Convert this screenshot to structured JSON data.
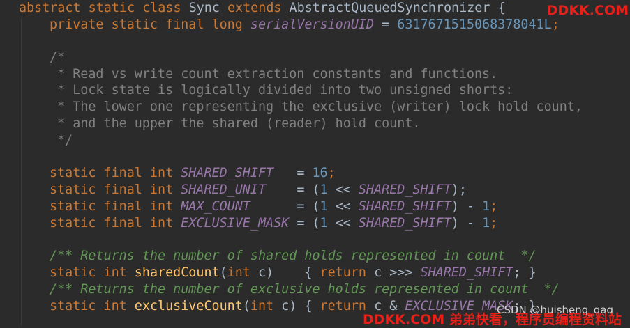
{
  "code": {
    "l1": {
      "kw": "abstract static class ",
      "cls": "Sync ",
      "kw2": "extends ",
      "sup": "AbstractQueuedSynchronizer {"
    },
    "l2": {
      "kw": "private static final long ",
      "fld": "serialVersionUID",
      "eq": " = ",
      "num": "6317671515068378041L",
      "semi": ";"
    },
    "c1": "/*",
    "c2": " * Read vs write count extraction constants and functions.",
    "c3": " * Lock state is logically divided into two unsigned shorts:",
    "c4": " * The lower one representing the exclusive (writer) lock hold count,",
    "c5": " * and the upper the shared (reader) hold count.",
    "c6": " */",
    "s1": {
      "kw": "static final int ",
      "fld": "SHARED_SHIFT",
      "eq": "   = ",
      "num": "16",
      "semi": ";"
    },
    "s2": {
      "kw": "static final int ",
      "fld": "SHARED_UNIT",
      "eq": "    = (",
      "num": "1",
      "op": " << ",
      "fld2": "SHARED_SHIFT",
      "end": ");"
    },
    "s3": {
      "kw": "static final int ",
      "fld": "MAX_COUNT",
      "eq": "      = (",
      "num": "1",
      "op": " << ",
      "fld2": "SHARED_SHIFT",
      "mid": ") - ",
      "num2": "1",
      "semi": ";"
    },
    "s4": {
      "kw": "static final int ",
      "fld": "EXCLUSIVE_MASK",
      "eq": " = (",
      "num": "1",
      "op": " << ",
      "fld2": "SHARED_SHIFT",
      "mid": ") - ",
      "num2": "1",
      "semi": ";"
    },
    "d1": "/** Returns the number of shared holds represented in count  */",
    "m1": {
      "kw": "static int ",
      "fn": "sharedCount",
      "p1": "(",
      "kw2": "int ",
      "p2": "c)    { ",
      "kw3": "return ",
      "p3": "c >>> ",
      "fld": "SHARED_SHIFT",
      "end": "; }"
    },
    "d2": "/** Returns the number of exclusive holds represented in count  */",
    "m2": {
      "kw": "static int ",
      "fn": "exclusiveCount",
      "p1": "(",
      "kw2": "int ",
      "p2": "c) { ",
      "kw3": "return ",
      "p3": "c & ",
      "fld": "EXCLUSIVE_MASK",
      "end": "; }"
    }
  },
  "watermarks": {
    "top": "DDKK.COM",
    "csdn": "CSDN @huisheng_qaq",
    "bottom": "DDKK.COM 弟弟快看，程序员编程资料站"
  },
  "colors": {
    "background": "#2b2b2b",
    "keyword": "#cc7832",
    "field": "#9876aa",
    "number": "#6897bb",
    "comment": "#808080",
    "doc_comment": "#629755",
    "method": "#ffc66d",
    "text": "#a9b7c6",
    "watermark": "#e8201a"
  }
}
